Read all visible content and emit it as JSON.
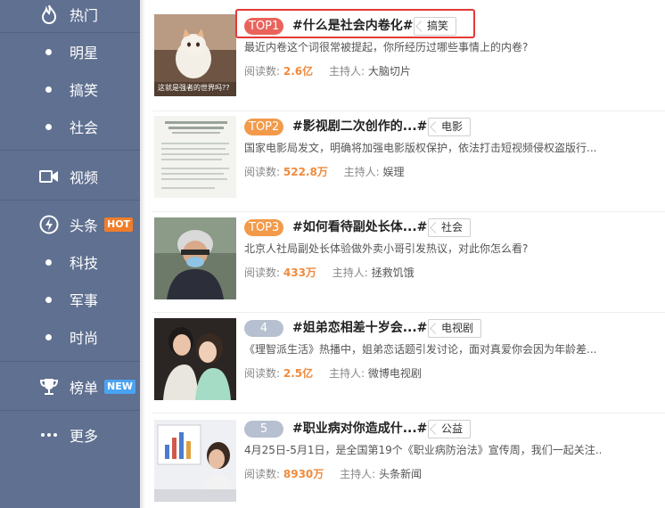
{
  "sidebar": {
    "items": [
      {
        "label": "热门",
        "type": "icon",
        "icon": "flame-icon"
      },
      {
        "label": "明星",
        "type": "dot"
      },
      {
        "label": "搞笑",
        "type": "dot"
      },
      {
        "label": "社会",
        "type": "dot"
      },
      {
        "label": "视频",
        "type": "icon",
        "icon": "video-camera-icon"
      },
      {
        "label": "头条",
        "type": "icon",
        "icon": "lightning-icon",
        "badge": "HOT"
      },
      {
        "label": "科技",
        "type": "dot"
      },
      {
        "label": "军事",
        "type": "dot"
      },
      {
        "label": "时尚",
        "type": "dot"
      },
      {
        "label": "榜单",
        "type": "icon",
        "icon": "trophy-icon",
        "badge": "NEW"
      },
      {
        "label": "更多",
        "type": "icon",
        "icon": "more-dots-icon"
      }
    ]
  },
  "topics": [
    {
      "rank": "TOP1",
      "title": "#什么是社会内卷化#",
      "tag": "搞笑",
      "summary": "最近内卷这个词很常被提起，你所经历过哪些事情上的内卷?",
      "read_label": "阅读数:",
      "reads": "2.6亿",
      "host_label": "主持人:",
      "host": "大脑切片",
      "thumb_caption": "这就是强者的世界吗??"
    },
    {
      "rank": "TOP2",
      "title": "#影视剧二次创作的...#",
      "tag": "电影",
      "summary": "国家电影局发文，明确将加强电影版权保护，依法打击短视频侵权盗版行...",
      "read_label": "阅读数:",
      "reads": "522.8万",
      "host_label": "主持人:",
      "host": "娱理"
    },
    {
      "rank": "TOP3",
      "title": "#如何看待副处长体...#",
      "tag": "社会",
      "summary": "北京人社局副处长体验做外卖小哥引发热议，对此你怎么看?",
      "read_label": "阅读数:",
      "reads": "433万",
      "host_label": "主持人:",
      "host": "拯救饥饿"
    },
    {
      "rank": "4",
      "title": "#姐弟恋相差十岁会...#",
      "tag": "电视剧",
      "summary": "《理智派生活》热播中，姐弟恋话题引发讨论，面对真爱你会因为年龄差...",
      "read_label": "阅读数:",
      "reads": "2.5亿",
      "host_label": "主持人:",
      "host": "微博电视剧"
    },
    {
      "rank": "5",
      "title": "#职业病对你造成什...#",
      "tag": "公益",
      "summary": "4月25日-5月1日，是全国第19个《职业病防治法》宣传周，我们一起关注...",
      "read_label": "阅读数:",
      "reads": "8930万",
      "host_label": "主持人:",
      "host": "头条新闻"
    }
  ],
  "colors": {
    "sidebar_bg": "#5f7090",
    "rank_hot": "#e9635b",
    "rank_orange": "#f29a4a",
    "rank_gray": "#b6c0d0",
    "reads_num": "#f08a3c",
    "highlight": "#e53935"
  }
}
